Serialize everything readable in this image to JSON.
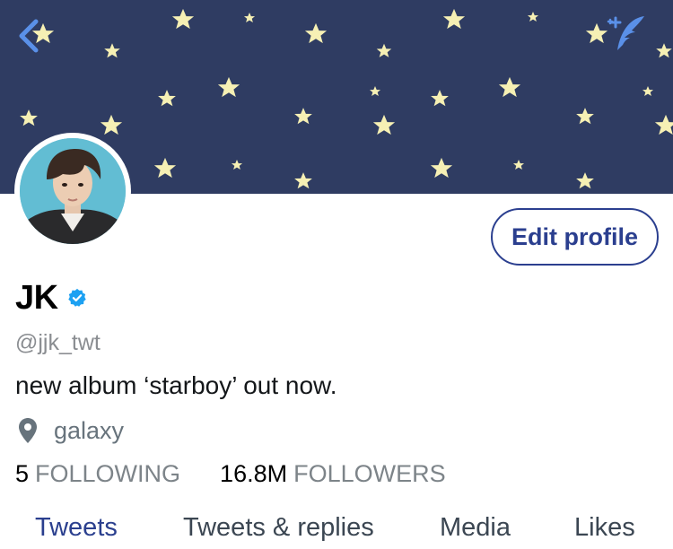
{
  "header": {
    "back_icon": "chevron-left-icon",
    "compose_icon": "feather-sparkle-icon",
    "banner_color": "#2f3c62",
    "star_color": "#f6f0b4"
  },
  "profile": {
    "avatar": "profile-photo",
    "edit_button_label": "Edit profile",
    "display_name": "JK",
    "verified_icon": "verified-badge-icon",
    "handle": "@jjk_twt",
    "bio": "new album ‘starboy’ out now.",
    "location_icon": "location-pin-icon",
    "location": "galaxy",
    "following_count": "5",
    "following_label": "FOLLOWING",
    "followers_count": "16.8M",
    "followers_label": "FOLLOWERS"
  },
  "tabs": [
    {
      "label": "Tweets",
      "active": true
    },
    {
      "label": "Tweets & replies",
      "active": false
    },
    {
      "label": "Media",
      "active": false
    },
    {
      "label": "Likes",
      "active": false
    }
  ],
  "colors": {
    "accent": "#2a3f8e",
    "verified": "#1da1f2",
    "muted": "#7d8489"
  }
}
